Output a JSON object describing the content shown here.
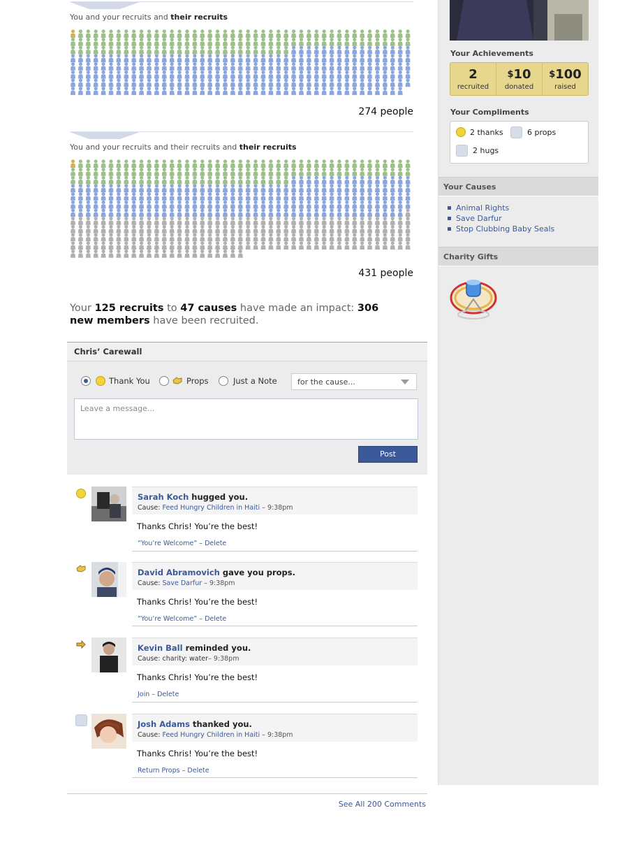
{
  "pyramid1": {
    "caption_prefix": "You and your recruits and ",
    "caption_bold": "their recruits",
    "count_label": "274 people"
  },
  "pyramid2": {
    "caption_prefix": "You and your recruits and their recruits and ",
    "caption_bold": "their recruits",
    "count_label": "431 people"
  },
  "impact": {
    "t1": "Your ",
    "b1": "125 recruits",
    "t2": " to ",
    "b2": "47 causes",
    "t3": " have made an impact: ",
    "b3": "306 new members",
    "t4": " have been recruited."
  },
  "carewall": {
    "title": "Chris’ Carewall",
    "option_thank": "Thank You",
    "option_props": "Props",
    "option_note": "Just a Note",
    "cause_select": "for the cause...",
    "message_placeholder": "Leave a message...",
    "post_label": "Post"
  },
  "comments": [
    {
      "name": "Sarah Koch",
      "action": " hugged you.",
      "cause_label": "Cause: ",
      "cause": "Feed Hungry Children in Haiti",
      "time": " – 9:38pm",
      "text": "Thanks Chris! You’re the best!",
      "action1": "“You’re Welcome”",
      "sep": " – ",
      "action2": "Delete",
      "icon": "smiley-icon"
    },
    {
      "name": "David Abramovich",
      "action": " gave you props.",
      "cause_label": "Cause: ",
      "cause": "Save Darfur",
      "time": " – 9:38pm",
      "text": "Thanks Chris! You’re the best!",
      "action1": "“You’re Welcome”",
      "sep": " – ",
      "action2": "Delete",
      "icon": "props-icon"
    },
    {
      "name": "Kevin Ball",
      "action": " reminded you.",
      "cause_label": "Cause: ",
      "cause": "charity: water",
      "time": "– 9:38pm",
      "text": "Thanks Chris! You’re the best!",
      "action1": "Join",
      "sep": " – ",
      "action2": "Delete",
      "icon": "reminder-icon"
    },
    {
      "name": "Josh Adams",
      "action": " thanked you.",
      "cause_label": "Cause: ",
      "cause": "Feed Hungry Children in Haiti",
      "time": " – 9:38pm",
      "text": "Thanks Chris! You’re the best!",
      "action1": "Return Props",
      "sep": " – ",
      "action2": "Delete",
      "icon": "hug-icon"
    }
  ],
  "see_all": "See All 200 Comments",
  "sidebar": {
    "achievements_heading": "Your Achievements",
    "ach": [
      {
        "value": "2",
        "label": "recruited"
      },
      {
        "value": "10",
        "prefix": "$",
        "label": "donated"
      },
      {
        "value": "100",
        "prefix": "$",
        "label": "raised"
      }
    ],
    "compliments_heading": "Your Compliments",
    "thanks": "2 thanks",
    "props": "6 props",
    "hugs": "2 hugs",
    "causes_heading": "Your Causes",
    "causes": [
      "Animal Rights",
      "Save Darfur",
      "Stop Clubbing Baby Seals"
    ],
    "gifts_heading": "Charity Gifts"
  },
  "colors": {
    "link": "#3b5998",
    "green_figure": "#9dbf8a",
    "blue_figure": "#8aa6dc",
    "gray_figure": "#b0b0b0",
    "gold_figure": "#d4b25a"
  }
}
